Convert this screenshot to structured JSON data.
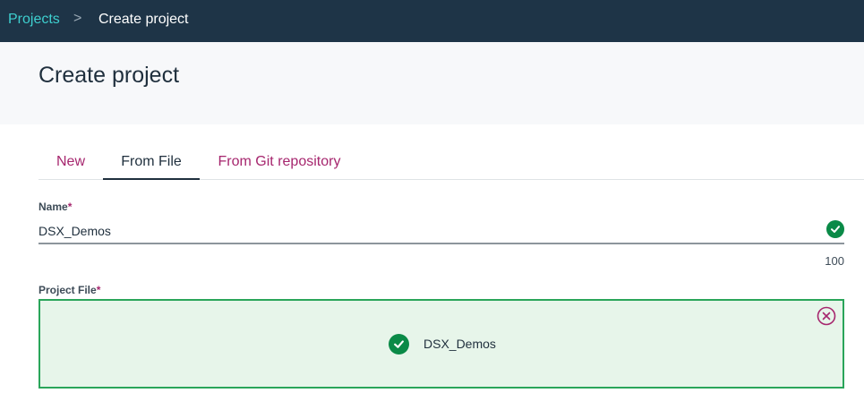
{
  "breadcrumb": {
    "parent": "Projects",
    "separator": ">",
    "current": "Create project"
  },
  "page": {
    "title": "Create project"
  },
  "tabs": [
    {
      "label": "New",
      "active": false
    },
    {
      "label": "From File",
      "active": true
    },
    {
      "label": "From Git repository",
      "active": false
    }
  ],
  "form": {
    "name": {
      "label": "Name",
      "required_mark": "*",
      "value": "DSX_Demos",
      "char_limit": "100",
      "status_icon": "check-circle-icon"
    },
    "project_file": {
      "label": "Project File",
      "required_mark": "*",
      "file_name": "DSX_Demos",
      "status_icon": "check-circle-icon",
      "remove_icon": "close-circle-icon"
    }
  },
  "colors": {
    "topbar": "#1e3447",
    "link_accent": "#3ecfcf",
    "tab_inactive": "#a6266e",
    "success": "#0a8a47",
    "dropzone_bg": "#e7f5ea",
    "dropzone_border": "#2aa55a"
  }
}
